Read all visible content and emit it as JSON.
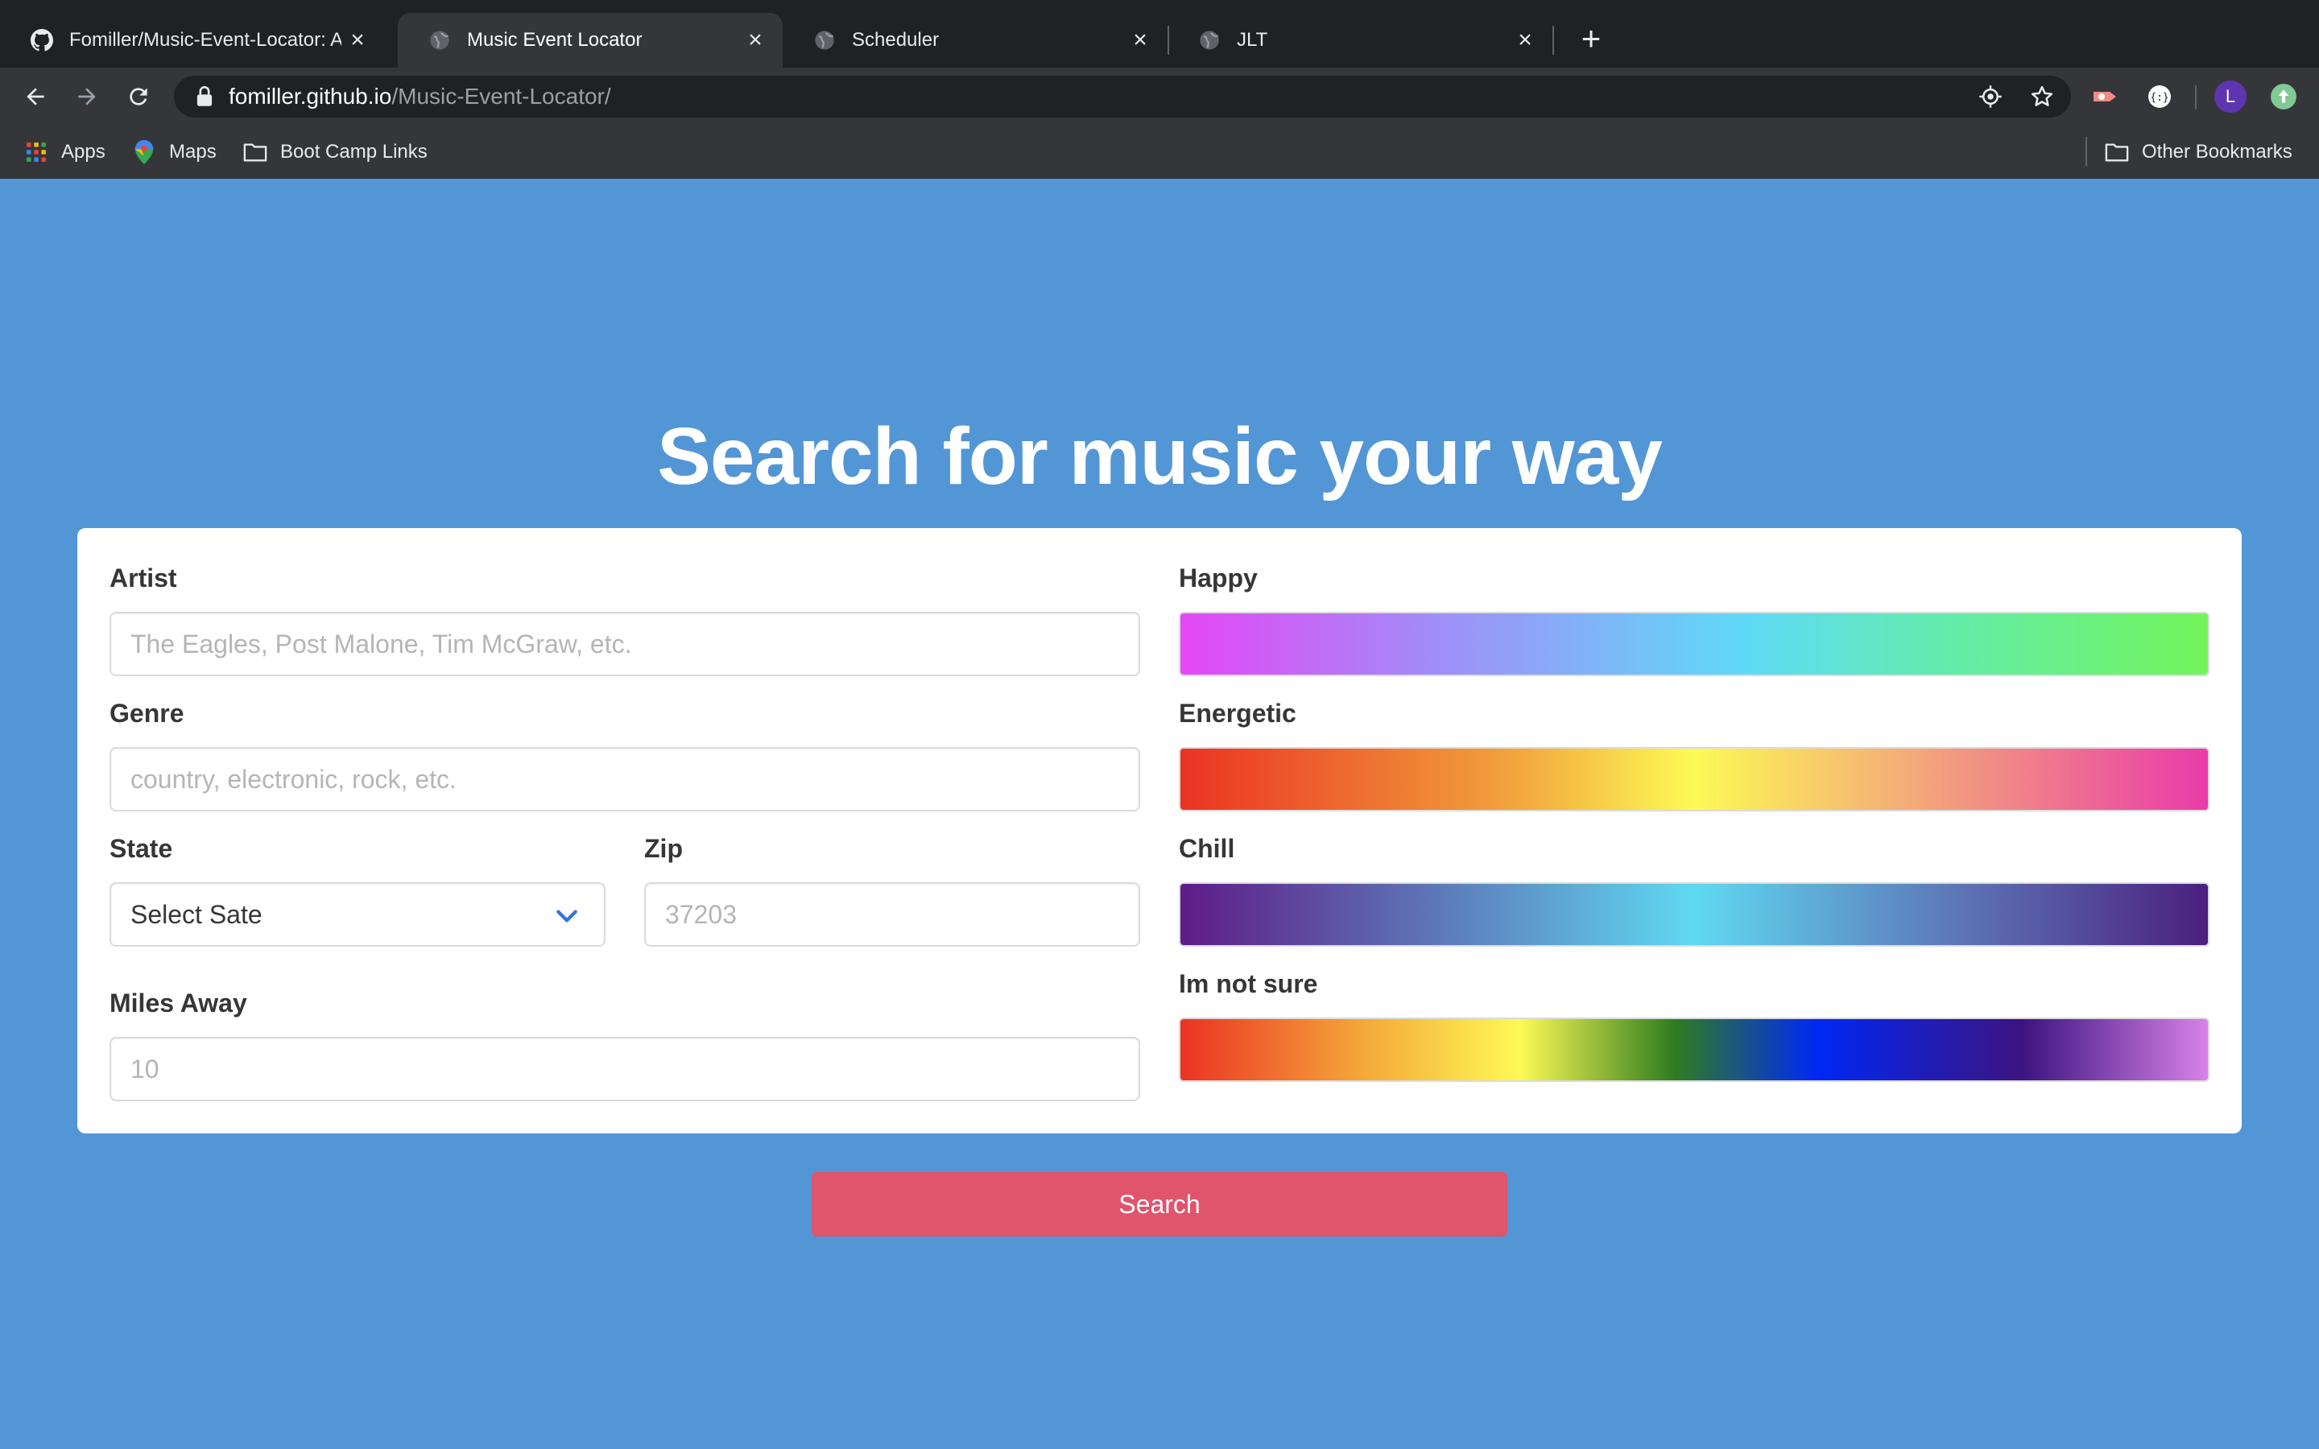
{
  "browser": {
    "tabs": [
      {
        "title": "Fomiller/Music-Event-Locator: A",
        "icon": "github-icon",
        "active": false
      },
      {
        "title": "Music Event Locator",
        "icon": "globe-icon",
        "active": true
      },
      {
        "title": "Scheduler",
        "icon": "globe-icon",
        "active": false
      },
      {
        "title": "JLT",
        "icon": "globe-icon",
        "active": false
      }
    ],
    "url_host": "fomiller.github.io",
    "url_path": "/Music-Event-Locator/",
    "profile_initial": "L",
    "bookmarks": {
      "apps": "Apps",
      "maps": "Maps",
      "boot_camp": "Boot Camp Links",
      "other": "Other Bookmarks"
    }
  },
  "page": {
    "heading": "Search for music your way",
    "form": {
      "artist_label": "Artist",
      "artist_placeholder": "The Eagles, Post Malone, Tim McGraw, etc.",
      "genre_label": "Genre",
      "genre_placeholder": "country, electronic, rock, etc.",
      "state_label": "State",
      "state_value": "Select Sate",
      "zip_label": "Zip",
      "zip_placeholder": "37203",
      "miles_label": "Miles Away",
      "miles_placeholder": "10"
    },
    "moods": {
      "happy": "Happy",
      "energetic": "Energetic",
      "chill": "Chill",
      "not_sure": "Im not sure"
    },
    "search_button": "Search"
  },
  "colors": {
    "page_background": "#5296d6",
    "search_button": "#e0546c",
    "card_background": "#ffffff"
  }
}
